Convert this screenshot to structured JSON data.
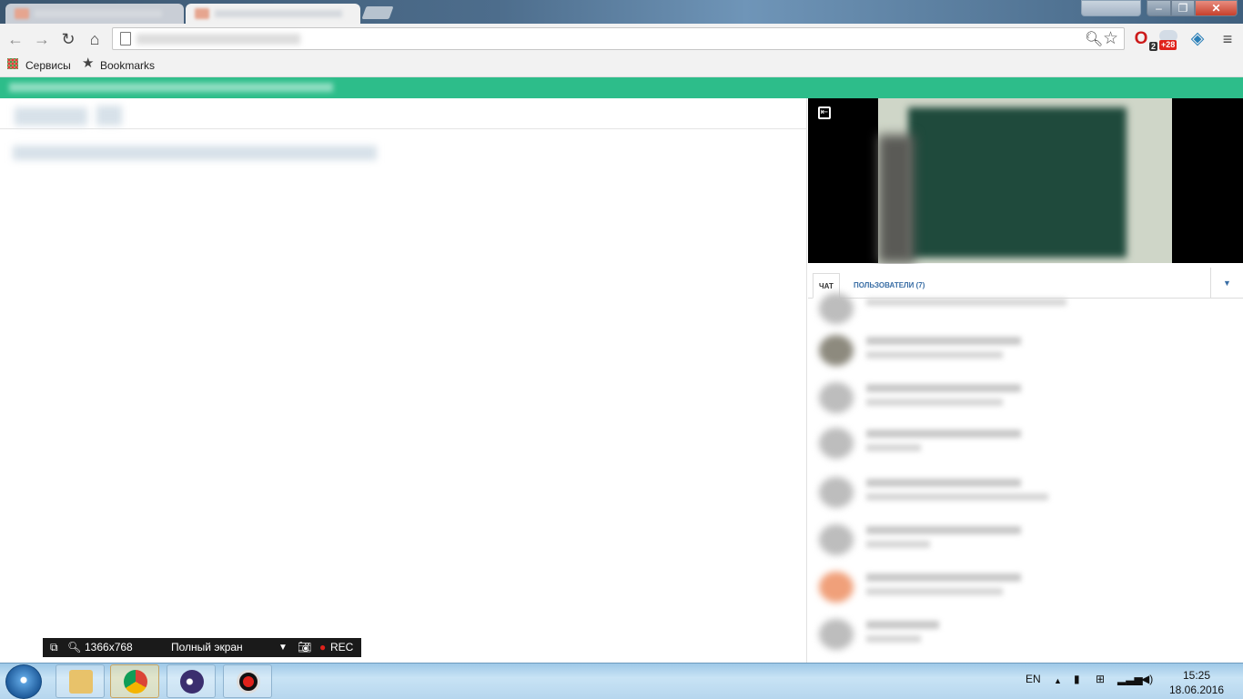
{
  "bookmarks_bar": {
    "apps_label": "Сервисы",
    "bookmarks_label": "Bookmarks"
  },
  "chat_panel": {
    "tab_chat": "ЧАТ",
    "tab_users": "ПОЛЬЗОВАТЕЛИ (7)"
  },
  "recorder_bar": {
    "resolution": "1366x768",
    "mode": "Полный экран",
    "rec_label": "REC"
  },
  "taskbar": {
    "language": "EN",
    "time": "15:25",
    "date": "18.06.2016"
  },
  "colors": {
    "accent_green": "#2dbd8a",
    "link_blue": "#3a6ea5",
    "rec_red": "#e0221b"
  },
  "icons": [
    "back-icon",
    "forward-icon",
    "reload-icon",
    "home-icon",
    "page-icon",
    "zoom-icon",
    "bookmark-star-icon",
    "opera-extension-icon",
    "cloud-extension-icon",
    "dropbox-extension-icon",
    "menu-icon",
    "apps-icon",
    "exit-fullscreen-icon",
    "start-orb-icon",
    "explorer-icon",
    "chrome-icon",
    "eclipse-icon",
    "record-icon"
  ],
  "extension_badges": {
    "opera_count": "2",
    "cloud_count": "+28"
  }
}
